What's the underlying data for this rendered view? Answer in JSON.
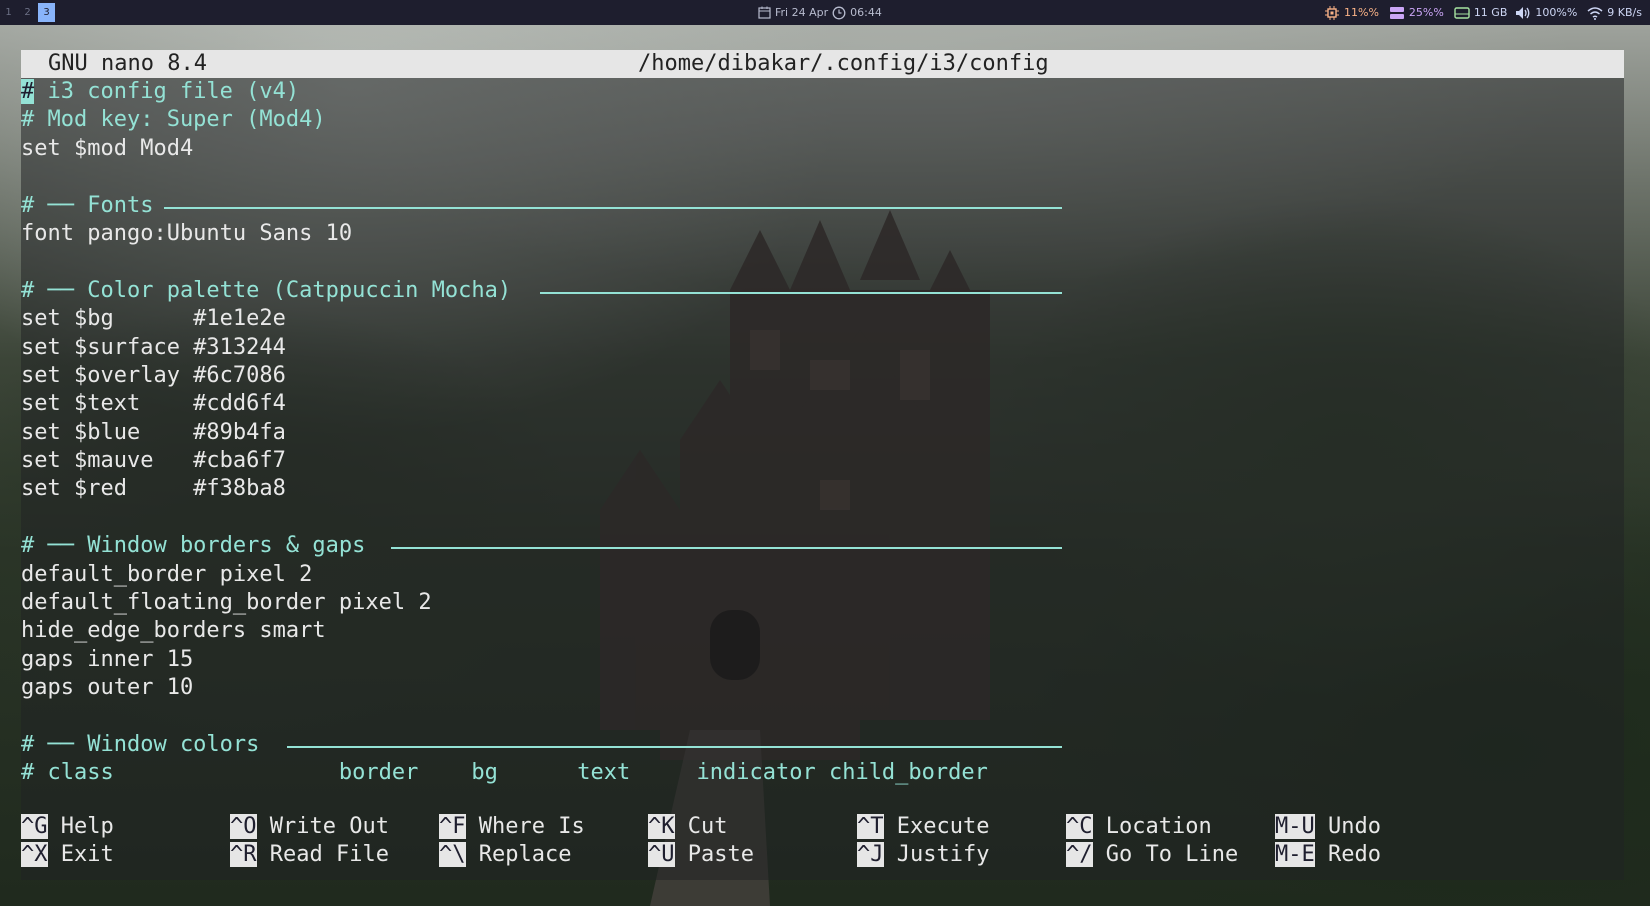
{
  "topbar": {
    "workspaces": [
      "1",
      "2",
      "3"
    ],
    "active_workspace": "3",
    "date": "Fri 24 Apr",
    "time": "06:44",
    "cpu": "11%%",
    "mem": "25%%",
    "disk": "11  GB",
    "volume": "100%%",
    "net": "9  KB/s"
  },
  "titlebar": {
    "app": "GNU nano 8.4",
    "path": "/home/dibakar/.config/i3/config"
  },
  "editor_lines": [
    "# i3 config file (v4)",
    "# Mod key: Super (Mod4)",
    "set $mod Mod4",
    "",
    "# ── Fonts",
    "font pango:Ubuntu Sans 10",
    "",
    "# ── Color palette (Catppuccin Mocha)",
    "set $bg      #1e1e2e",
    "set $surface #313244",
    "set $overlay #6c7086",
    "set $text    #cdd6f4",
    "set $blue    #89b4fa",
    "set $mauve   #cba6f7",
    "set $red     #f38ba8",
    "",
    "# ── Window borders & gaps",
    "default_border pixel 2",
    "default_floating_border pixel 2",
    "hide_edge_borders smart",
    "gaps inner 15",
    "gaps outer 10",
    "",
    "# ── Window colors",
    "# class                 border    bg      text     indicator child_border"
  ],
  "shortcuts": [
    [
      {
        "key": "^G",
        "label": "Help"
      },
      {
        "key": "^O",
        "label": "Write Out"
      },
      {
        "key": "^F",
        "label": "Where Is"
      },
      {
        "key": "^K",
        "label": "Cut"
      },
      {
        "key": "^T",
        "label": "Execute"
      },
      {
        "key": "^C",
        "label": "Location"
      },
      {
        "key": "M-U",
        "label": "Undo"
      }
    ],
    [
      {
        "key": "^X",
        "label": "Exit"
      },
      {
        "key": "^R",
        "label": "Read File"
      },
      {
        "key": "^\\",
        "label": "Replace"
      },
      {
        "key": "^U",
        "label": "Paste"
      },
      {
        "key": "^J",
        "label": "Justify"
      },
      {
        "key": "^/",
        "label": "Go To Line"
      },
      {
        "key": "M-E",
        "label": "Redo"
      }
    ]
  ],
  "colors": {
    "comment": "#94e2d5",
    "bar_bg": "#1e1e2e",
    "accent": "#89b4fa"
  }
}
